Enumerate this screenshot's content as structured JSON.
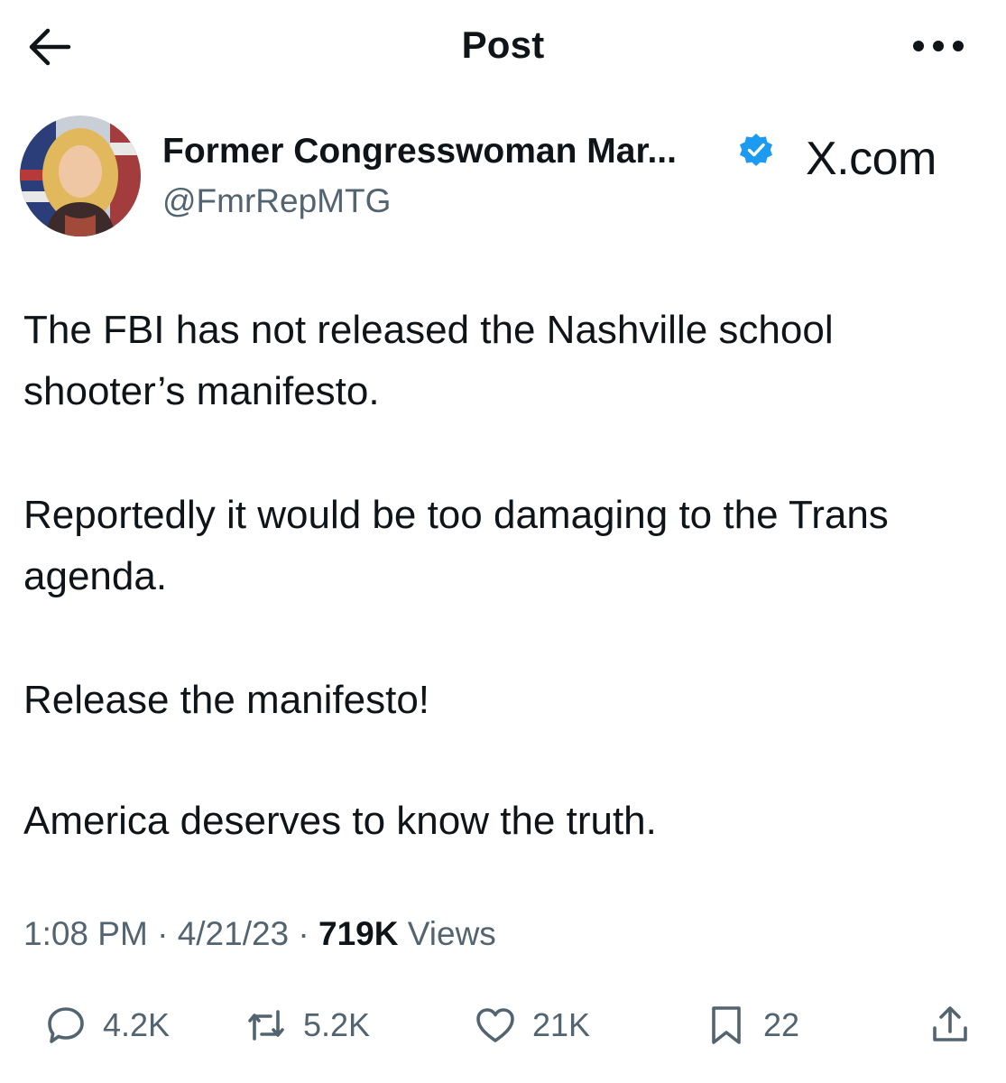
{
  "header": {
    "title": "Post"
  },
  "author": {
    "display_name": "Former Congresswoman Mar...",
    "handle": "@FmrRepMTG",
    "verified": true,
    "badge_color": "#1d9bf0"
  },
  "source_label": "X.com",
  "post": {
    "paragraphs": [
      "The FBI has not released the Nashville school shooter’s manifesto.",
      "Reportedly it would be too damaging to the Trans agenda.",
      "Release the manifesto!",
      "America deserves to know the truth."
    ]
  },
  "meta": {
    "time": "1:08 PM",
    "date": "4/21/23",
    "separator": "·",
    "views_count": "719K",
    "views_label": "Views"
  },
  "actions": {
    "replies": "4.2K",
    "reposts": "5.2K",
    "likes": "21K",
    "bookmarks": "22"
  },
  "icons": {
    "back": "arrow-left-icon",
    "more": "more-dots-icon",
    "verified": "verified-check-icon",
    "reply": "speech-bubble-icon",
    "repost": "repost-arrows-icon",
    "like": "heart-icon",
    "bookmark": "bookmark-icon",
    "share": "share-upload-icon"
  },
  "colors": {
    "text_primary": "#0f1419",
    "text_secondary": "#536471",
    "accent": "#1d9bf0"
  }
}
